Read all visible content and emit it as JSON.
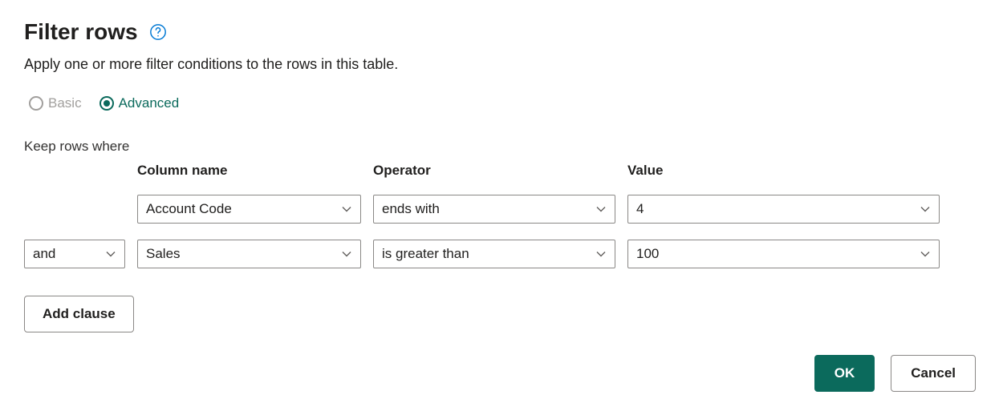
{
  "header": {
    "title": "Filter rows",
    "subtitle": "Apply one or more filter conditions to the rows in this table."
  },
  "mode": {
    "basic_label": "Basic",
    "advanced_label": "Advanced",
    "selected": "advanced"
  },
  "keep_rows_label": "Keep rows where",
  "columns": {
    "column_name_header": "Column name",
    "operator_header": "Operator",
    "value_header": "Value"
  },
  "clauses": [
    {
      "conjunction": null,
      "column": "Account Code",
      "operator": "ends with",
      "value": "4"
    },
    {
      "conjunction": "and",
      "column": "Sales",
      "operator": "is greater than",
      "value": "100"
    }
  ],
  "buttons": {
    "add_clause": "Add clause",
    "ok": "OK",
    "cancel": "Cancel"
  }
}
